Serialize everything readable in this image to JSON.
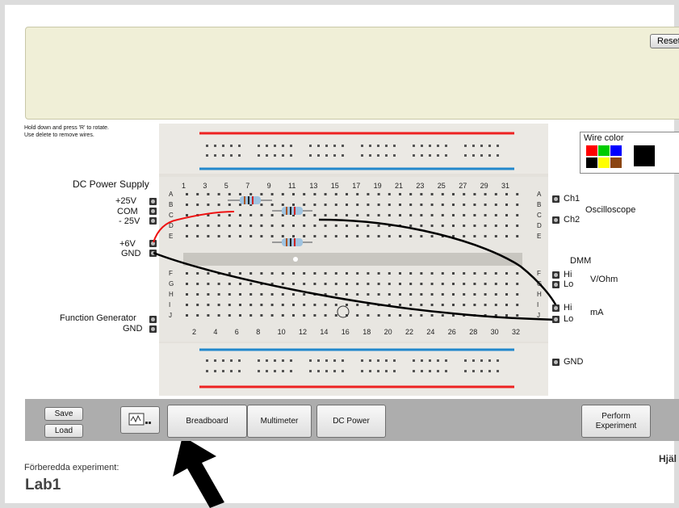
{
  "header": {
    "reset_label": "Reset"
  },
  "help": {
    "line1": "Hold down and press 'R' to rotate.",
    "line2": "Use delete to remove wires."
  },
  "left_panel": {
    "dc_title": "DC Power Supply",
    "p25": "+25V",
    "com": "COM",
    "m25": "- 25V",
    "p6": "+6V",
    "gnd1": "GND",
    "fg_title": "Function Generator",
    "gnd2": "GND"
  },
  "breadboard": {
    "top_numbers": [
      "1",
      "3",
      "5",
      "7",
      "9",
      "11",
      "13",
      "15",
      "17",
      "19",
      "21",
      "23",
      "25",
      "27",
      "29",
      "31"
    ],
    "bottom_numbers": [
      "2",
      "4",
      "6",
      "8",
      "10",
      "12",
      "14",
      "16",
      "18",
      "20",
      "22",
      "24",
      "26",
      "28",
      "30",
      "32"
    ],
    "rows_upper": [
      "A",
      "B",
      "C",
      "D",
      "E"
    ],
    "rows_lower": [
      "F",
      "G",
      "H",
      "I",
      "J"
    ]
  },
  "right_panel": {
    "ch1": "Ch1",
    "ch2": "Ch2",
    "osc": "Oscilloscope",
    "dmm": "DMM",
    "hi1": "Hi",
    "lo1": "Lo",
    "vohm": "V/Ohm",
    "hi2": "Hi",
    "lo2": "Lo",
    "ma": "mA",
    "gnd": "GND"
  },
  "wire_color": {
    "title": "Wire color",
    "colors": [
      "#ff0000",
      "#00cc00",
      "#0000ff",
      "#000000",
      "#ffff00",
      "#8b4513"
    ],
    "selected": "#000000"
  },
  "toolbar": {
    "save": "Save",
    "load": "Load",
    "breadboard": "Breadboard",
    "multimeter": "Multimeter",
    "dc_power": "DC Power",
    "perform1": "Perform",
    "perform2": "Experiment"
  },
  "footer": {
    "prepared": "Förberedda experiment:",
    "lab": "Lab1",
    "help": "Hjäl"
  }
}
